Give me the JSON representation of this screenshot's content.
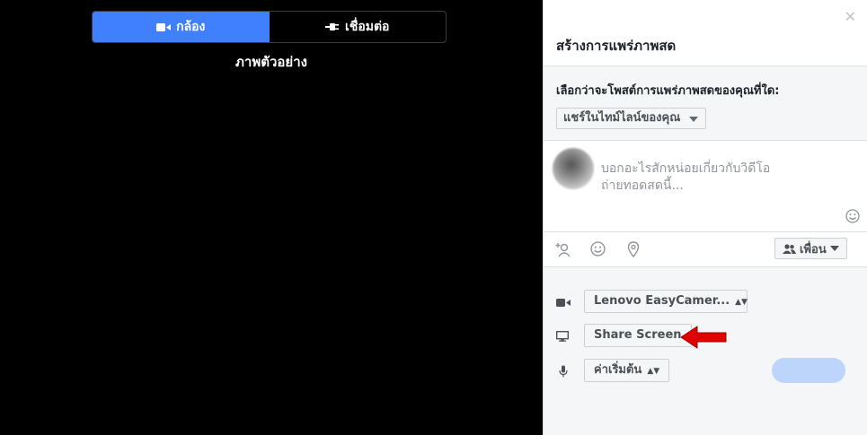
{
  "preview": {
    "tabs": [
      {
        "label": "กล้อง",
        "icon": "video-camera-icon",
        "active": true
      },
      {
        "label": "เชื่อมต่อ",
        "icon": "plug-icon",
        "active": false
      }
    ],
    "preview_label": "ภาพตัวอย่าง"
  },
  "panel": {
    "title": "สร้างการแพร่ภาพสด",
    "where_label": "เลือกว่าจะโพสต์การแพร่ภาพสดของคุณที่ใด:",
    "where_selected": "แชร์ในไทม์ไลน์ของคุณ",
    "composer_placeholder": "บอกอะไรสักหน่อยเกี่ยวกับวิดีโอถ่ายทอดสดนี้...",
    "audience_label": "เพื่อน",
    "camera_source": "Lenovo EasyCamer...",
    "share_screen_label": "Share Screen",
    "mic_source": "ค่าเริ่มต้น"
  },
  "colors": {
    "accent": "#4080ff",
    "go_live_disabled": "#bdd4fb",
    "annotation_arrow": "#e00000"
  }
}
